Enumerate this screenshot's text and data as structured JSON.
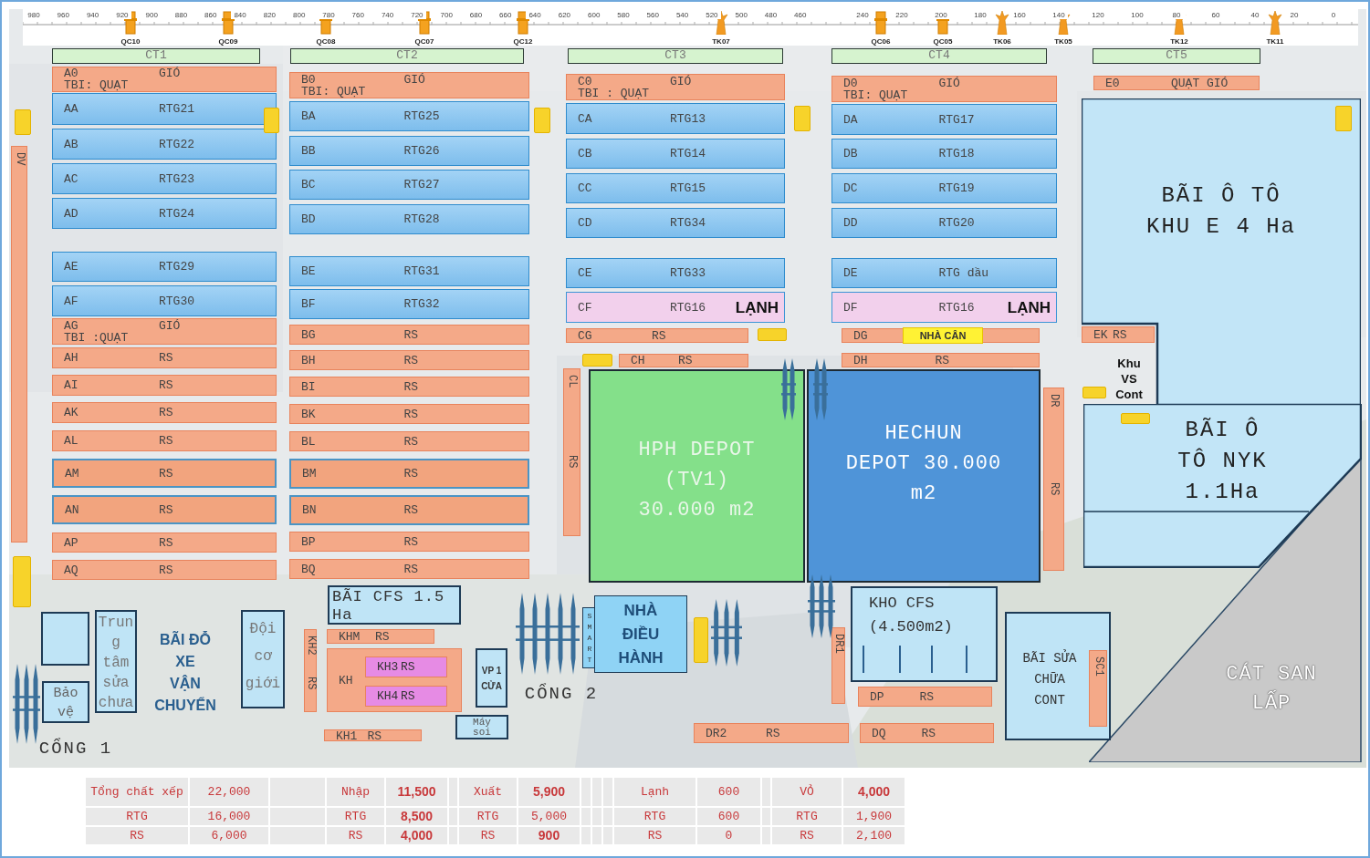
{
  "ruler": {
    "ticks": [
      "980",
      "960",
      "940",
      "920",
      "900",
      "880",
      "860",
      "840",
      "820",
      "800",
      "780",
      "760",
      "740",
      "720",
      "700",
      "680",
      "660",
      "640",
      "620",
      "600",
      "580",
      "560",
      "540",
      "520",
      "500",
      "480",
      "460",
      "240",
      "220",
      "200",
      "180",
      "160",
      "140",
      "120",
      "100",
      "80",
      "60",
      "40",
      "20",
      "0"
    ]
  },
  "cranes": [
    {
      "label": "QC10",
      "kind": "qc"
    },
    {
      "label": "QC09",
      "kind": "qc"
    },
    {
      "label": "QC08",
      "kind": "qc"
    },
    {
      "label": "QC07",
      "kind": "qc"
    },
    {
      "label": "QC12",
      "kind": "qc"
    },
    {
      "label": "TK07",
      "kind": "tk"
    },
    {
      "label": "QC06",
      "kind": "qc"
    },
    {
      "label": "QC05",
      "kind": "qc"
    },
    {
      "label": "TK06",
      "kind": "tk"
    },
    {
      "label": "TK05",
      "kind": "tk"
    },
    {
      "label": "TK12",
      "kind": "tk"
    },
    {
      "label": "TK11",
      "kind": "tk"
    }
  ],
  "zones": [
    "CT1",
    "CT2",
    "CT3",
    "CT4",
    "CT5"
  ],
  "areas": [
    {
      "kind": "lot",
      "label": "BÃI Ô TÔ\nKHU E 4 Ha"
    },
    {
      "kind": "note",
      "label": "Khu\nVS\nCont"
    },
    {
      "kind": "sand",
      "label": "CÁT SAN\nLẤP"
    },
    {
      "kind": "lot",
      "label": "BÃI Ô\nTÔ  NYK\n1.1Ha"
    },
    {
      "kind": "depot",
      "label": "HPH DEPOT\n(TV1)\n30.000 m2"
    },
    {
      "kind": "hub",
      "label": "HECHUN\nDEPOT 30.000\nm2"
    },
    {
      "kind": "lot",
      "label": "KHO CFS\n(4.500m2)"
    },
    {
      "kind": "lot",
      "label": "BÃI SỬA\nCHỮA\nCONT"
    },
    {
      "kind": "strip",
      "label": "SMART"
    },
    {
      "kind": "office",
      "label": "NHÀ\nĐIỀU\nHÀNH"
    },
    {
      "kind": "lot",
      "label": "BÃI CFS 1.5\nHa"
    },
    {
      "kind": "lot",
      "label": "VP 1\nCỬA"
    },
    {
      "kind": "lot",
      "label": "Máy\nsoi"
    },
    {
      "kind": "lot"
    },
    {
      "kind": "lot",
      "label": "Trun\ng\ntâm\nsửa\nchưa"
    },
    {
      "kind": "lot",
      "label": "Bảo\nvệ"
    },
    {
      "kind": "note",
      "label": "BÃI ĐỖ\nXE\nVẬN\nCHUYỂN"
    },
    {
      "kind": "lot",
      "label": "Đội\ncơ\ngiới"
    },
    {
      "kind": "gate",
      "label": "CỔNG 1"
    },
    {
      "kind": "gate",
      "label": "CỔNG 2"
    }
  ],
  "blocks": [
    {
      "kind": "wind",
      "code": "A0",
      "equipment": "GIÓ",
      "note": "TBI: QUẠT"
    },
    {
      "kind": "rtg",
      "code": "AA",
      "equipment": "RTG21"
    },
    {
      "kind": "rtg",
      "code": "AB",
      "equipment": "RTG22"
    },
    {
      "kind": "rtg",
      "code": "AC",
      "equipment": "RTG23"
    },
    {
      "kind": "rtg",
      "code": "AD",
      "equipment": "RTG24"
    },
    {
      "kind": "rtg",
      "code": "AE",
      "equipment": "RTG29"
    },
    {
      "kind": "rtg",
      "code": "AF",
      "equipment": "RTG30"
    },
    {
      "kind": "wind",
      "code": "AG",
      "equipment": "GIÓ",
      "note": "TBI :QUẠT"
    },
    {
      "kind": "rs",
      "code": "AH",
      "equipment": "RS"
    },
    {
      "kind": "rs",
      "code": "AI",
      "equipment": "RS"
    },
    {
      "kind": "rs",
      "code": "AK",
      "equipment": "RS"
    },
    {
      "kind": "rs",
      "code": "AL",
      "equipment": "RS"
    },
    {
      "kind": "bordered",
      "code": "AM",
      "equipment": "RS"
    },
    {
      "kind": "bordered",
      "code": "AN",
      "equipment": "RS"
    },
    {
      "kind": "rs",
      "code": "AP",
      "equipment": "RS"
    },
    {
      "kind": "rs",
      "code": "AQ",
      "equipment": "RS"
    },
    {
      "kind": "wind",
      "code": "B0",
      "equipment": "GIÓ",
      "note": "TBI: QUẠT"
    },
    {
      "kind": "rtg",
      "code": "BA",
      "equipment": "RTG25"
    },
    {
      "kind": "rtg",
      "code": "BB",
      "equipment": "RTG26"
    },
    {
      "kind": "rtg",
      "code": "BC",
      "equipment": "RTG27"
    },
    {
      "kind": "rtg",
      "code": "BD",
      "equipment": "RTG28"
    },
    {
      "kind": "rtg",
      "code": "BE",
      "equipment": "RTG31"
    },
    {
      "kind": "rtg",
      "code": "BF",
      "equipment": "RTG32"
    },
    {
      "kind": "rs",
      "code": "BG",
      "equipment": "RS"
    },
    {
      "kind": "rs",
      "code": "BH",
      "equipment": "RS"
    },
    {
      "kind": "rs",
      "code": "BI",
      "equipment": "RS"
    },
    {
      "kind": "rs",
      "code": "BK",
      "equipment": "RS"
    },
    {
      "kind": "rs",
      "code": "BL",
      "equipment": "RS"
    },
    {
      "kind": "bordered",
      "code": "BM",
      "equipment": "RS"
    },
    {
      "kind": "bordered",
      "code": "BN",
      "equipment": "RS"
    },
    {
      "kind": "rs",
      "code": "BP",
      "equipment": "RS"
    },
    {
      "kind": "rs",
      "code": "BQ",
      "equipment": "RS"
    },
    {
      "kind": "wind",
      "code": "C0",
      "equipment": "GIÓ",
      "note": "TBI : QUẠT"
    },
    {
      "kind": "rtg",
      "code": "CA",
      "equipment": "RTG13"
    },
    {
      "kind": "rtg",
      "code": "CB",
      "equipment": "RTG14"
    },
    {
      "kind": "rtg",
      "code": "CC",
      "equipment": "RTG15"
    },
    {
      "kind": "rtg",
      "code": "CD",
      "equipment": "RTG34"
    },
    {
      "kind": "rtg",
      "code": "CE",
      "equipment": "RTG33"
    },
    {
      "kind": "reefer",
      "code": "CF",
      "equipment": "RTG16",
      "note": "LẠNH"
    },
    {
      "kind": "rs",
      "code": "CG",
      "equipment": "RS"
    },
    {
      "kind": "rs",
      "code": "CH",
      "equipment": "RS"
    },
    {
      "kind": "vertical",
      "code": "CL",
      "equipment": "RS"
    },
    {
      "kind": "wind",
      "code": "D0",
      "equipment": "GIÓ",
      "note": "TBI: QUẠT"
    },
    {
      "kind": "rtg",
      "code": "DA",
      "equipment": "RTG17"
    },
    {
      "kind": "rtg",
      "code": "DB",
      "equipment": "RTG18"
    },
    {
      "kind": "rtg",
      "code": "DC",
      "equipment": "RTG19"
    },
    {
      "kind": "rtg",
      "code": "DD",
      "equipment": "RTG20"
    },
    {
      "kind": "rtg",
      "code": "DE",
      "equipment": "RTG dầu"
    },
    {
      "kind": "reefer",
      "code": "DF",
      "equipment": "RTG16",
      "note": "LẠNH"
    },
    {
      "kind": "rs",
      "code": "DG"
    },
    {
      "kind": "rs",
      "code": "DH",
      "equipment": "RS"
    },
    {
      "kind": "vertical",
      "code": "DR",
      "equipment": "RS"
    },
    {
      "kind": "rs",
      "code": "E0",
      "equipment": "QUẠT GIÓ"
    },
    {
      "kind": "rs",
      "code": "EK",
      "equipment": "RS"
    },
    {
      "kind": "vertical",
      "code": "DV"
    },
    {
      "kind": "rs",
      "code": "KHM",
      "equipment": "RS"
    },
    {
      "kind": "vertical",
      "code": "KH2",
      "equipment": "RS"
    },
    {
      "kind": "rs",
      "code": "KH"
    },
    {
      "kind": "store",
      "code": "KH3",
      "equipment": "RS"
    },
    {
      "kind": "store",
      "code": "KH4",
      "equipment": "RS"
    },
    {
      "kind": "rs",
      "code": "KH1",
      "equipment": "RS"
    },
    {
      "kind": "vertical",
      "code": "DR1"
    },
    {
      "kind": "rs",
      "code": "DP",
      "equipment": "RS"
    },
    {
      "kind": "rs",
      "code": "DR2",
      "equipment": "RS"
    },
    {
      "kind": "rs",
      "code": "DQ",
      "equipment": "RS"
    },
    {
      "kind": "vertical",
      "code": "SC1"
    }
  ],
  "weighbridge": {
    "label": "NHÀ CÂN"
  },
  "table": {
    "rows": [
      [
        {
          "text": "Tổng chất xếp",
          "bold": false
        },
        {
          "text": "22,000",
          "bold": false
        },
        {
          "text": "Nhập",
          "bold": false
        },
        {
          "text": "11,500",
          "bold": true
        },
        {
          "text": "Xuất",
          "bold": false
        },
        {
          "text": "5,900",
          "bold": true
        },
        {
          "text": "Lạnh",
          "bold": false
        },
        {
          "text": "600",
          "bold": false
        },
        {
          "text": "VỎ",
          "bold": false
        },
        {
          "text": "4,000",
          "bold": true
        }
      ],
      [
        {
          "text": "RTG",
          "bold": false
        },
        {
          "text": "16,000",
          "bold": false
        },
        {
          "text": "RTG",
          "bold": false
        },
        {
          "text": "8,500",
          "bold": true
        },
        {
          "text": "RTG",
          "bold": false
        },
        {
          "text": "5,000",
          "bold": false
        },
        {
          "text": "RTG",
          "bold": false
        },
        {
          "text": "600",
          "bold": false
        },
        {
          "text": "RTG",
          "bold": false
        },
        {
          "text": "1,900",
          "bold": false
        }
      ],
      [
        {
          "text": "RS",
          "bold": false
        },
        {
          "text": "6,000",
          "bold": false
        },
        {
          "text": "RS",
          "bold": false
        },
        {
          "text": "4,000",
          "bold": true
        },
        {
          "text": "RS",
          "bold": false
        },
        {
          "text": "900",
          "bold": true
        },
        {
          "text": "RS",
          "bold": false
        },
        {
          "text": "0",
          "bold": false
        },
        {
          "text": "RS",
          "bold": false
        },
        {
          "text": "2,100",
          "bold": false
        }
      ]
    ]
  }
}
